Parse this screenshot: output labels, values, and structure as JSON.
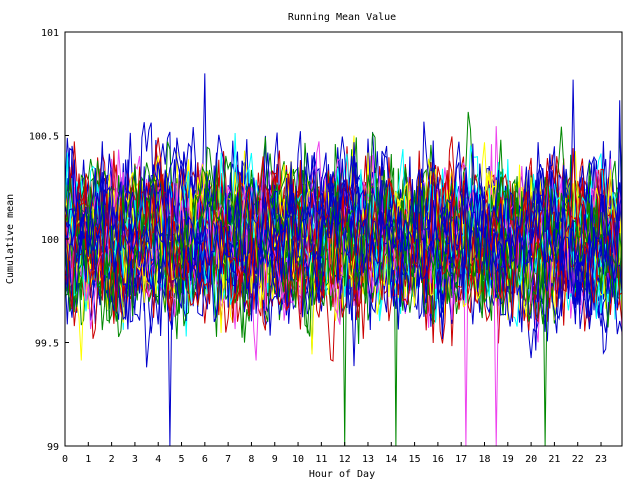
{
  "chart_data": {
    "type": "line",
    "title": "Running Mean Value",
    "xlabel": "Hour of Day",
    "ylabel": "Cumulative mean",
    "xlim": [
      0,
      23.9
    ],
    "ylim": [
      99,
      101
    ],
    "xticks": [
      0,
      1,
      2,
      3,
      4,
      5,
      6,
      7,
      8,
      9,
      10,
      11,
      12,
      13,
      14,
      15,
      16,
      17,
      18,
      19,
      20,
      21,
      22,
      23
    ],
    "xtick_labels": [
      "0",
      "1",
      "2",
      "3",
      "4",
      "5",
      "6",
      "7",
      "8",
      "9",
      "10",
      "11",
      "12",
      "13",
      "14",
      "15",
      "16",
      "17",
      "18",
      "19",
      "20",
      "21",
      "22",
      "23"
    ],
    "yticks": [
      99,
      99.5,
      100,
      100.5,
      101
    ],
    "ytick_labels": [
      "99",
      "99.5",
      "100",
      "100.5",
      "101"
    ],
    "grid": false,
    "legend": "none",
    "series_colors": [
      "#0000cc",
      "#cc0000",
      "#008800",
      "#ee44ee",
      "#ffff00",
      "#00ffff"
    ],
    "series_count_approx": 60,
    "points_per_series": 240,
    "center": 100.0,
    "typical_range": [
      99.6,
      100.4
    ],
    "notable_extremes": [
      {
        "x": 4.5,
        "y": 99.0
      },
      {
        "x": 6.0,
        "y": 100.8
      },
      {
        "x": 12.0,
        "y": 99.0
      },
      {
        "x": 14.2,
        "y": 99.0
      },
      {
        "x": 17.2,
        "y": 99.0
      },
      {
        "x": 18.5,
        "y": 99.0
      },
      {
        "x": 20.6,
        "y": 99.0
      },
      {
        "x": 21.8,
        "y": 100.77
      },
      {
        "x": 23.8,
        "y": 100.67
      }
    ]
  }
}
